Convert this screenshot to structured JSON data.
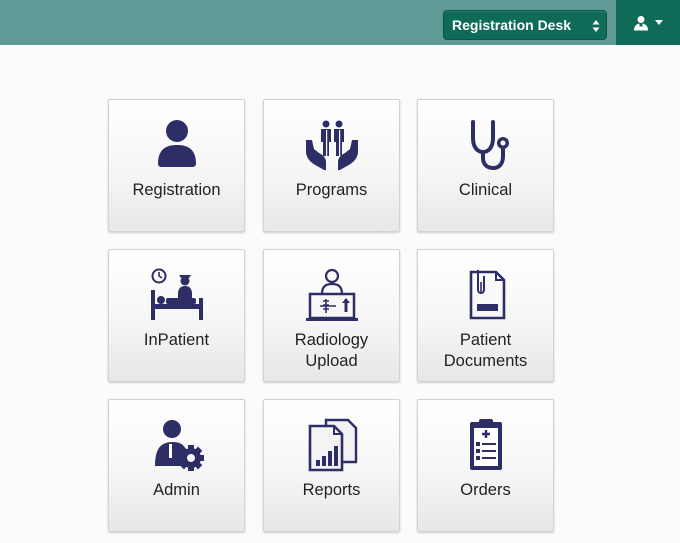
{
  "header": {
    "location": {
      "selected": "Registration Desk"
    },
    "user_menu": {
      "icon": "user-icon"
    }
  },
  "colors": {
    "topbar": "#5e9a96",
    "accent": "#0f6b57",
    "icon": "#2e2e66"
  },
  "apps": [
    {
      "label": "Registration",
      "icon": "person-icon"
    },
    {
      "label": "Programs",
      "icon": "family-care-icon"
    },
    {
      "label": "Clinical",
      "icon": "stethoscope-icon"
    },
    {
      "label": "InPatient",
      "icon": "hospital-bed-icon"
    },
    {
      "label": "Radiology\nUpload",
      "icon": "xray-icon"
    },
    {
      "label": "Patient\nDocuments",
      "icon": "document-clip-icon"
    },
    {
      "label": "Admin",
      "icon": "admin-gear-icon"
    },
    {
      "label": "Reports",
      "icon": "reports-icon"
    },
    {
      "label": "Orders",
      "icon": "clipboard-icon"
    }
  ]
}
